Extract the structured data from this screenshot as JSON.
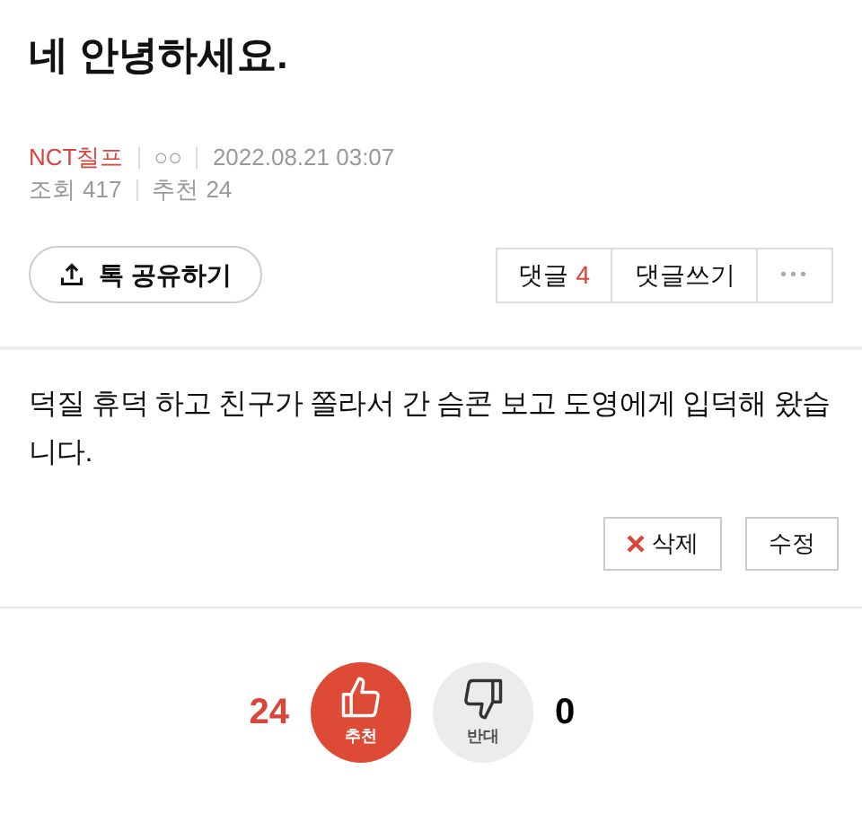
{
  "post": {
    "title": "네 안녕하세요.",
    "author": "NCT칠프",
    "badge": "○○",
    "date": "2022.08.21 03:07",
    "views_label": "조회",
    "views": "417",
    "recommend_label": "추천",
    "recommend": "24"
  },
  "share_button": "톡 공유하기",
  "comment_actions": {
    "comments_label": "댓글",
    "comments_count": "4",
    "write": "댓글쓰기",
    "more": "•••"
  },
  "body": "덕질 휴덕 하고 친구가 쫄라서 간 슴콘 보고 도영에게 입덕해 왔습니다.",
  "edit_actions": [
    {
      "kind": "delete",
      "label": "삭제"
    },
    {
      "kind": "edit",
      "label": "수정"
    }
  ],
  "votes": [
    {
      "kind": "up",
      "count": "24",
      "label": "추천",
      "selected": true
    },
    {
      "kind": "down",
      "count": "0",
      "label": "반대",
      "selected": false
    }
  ]
}
